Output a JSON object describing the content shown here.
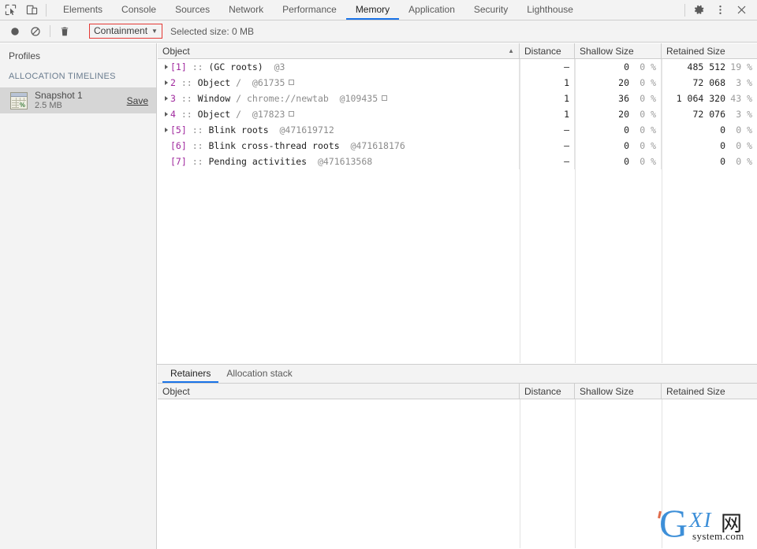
{
  "window": {
    "title": "Chrome DevTools — Memory"
  },
  "tabbar": {
    "inspect_icon": "inspect-cursor-icon",
    "device_icon": "device-toolbar-icon",
    "tabs": [
      {
        "label": "Elements",
        "active": false
      },
      {
        "label": "Console",
        "active": false
      },
      {
        "label": "Sources",
        "active": false
      },
      {
        "label": "Network",
        "active": false
      },
      {
        "label": "Performance",
        "active": false
      },
      {
        "label": "Memory",
        "active": true
      },
      {
        "label": "Application",
        "active": false
      },
      {
        "label": "Security",
        "active": false
      },
      {
        "label": "Lighthouse",
        "active": false
      }
    ],
    "settings_icon": "gear-icon",
    "more_icon": "kebab-menu-icon",
    "close_icon": "close-icon",
    "accent_color": "#1a73e8"
  },
  "toolbar": {
    "record_icon": "record-circle-icon",
    "clear_icon": "no-entry-icon",
    "delete_icon": "trash-icon",
    "view_select": "Containment",
    "view_select_caret": "▼",
    "selected_size_label": "Selected size: 0 MB",
    "highlight_color": "#e53935"
  },
  "sidebar": {
    "title": "Profiles",
    "section_label": "ALLOCATION TIMELINES",
    "item": {
      "icon": "heap-snapshot-icon",
      "icon_badge": "%",
      "name": "Snapshot 1",
      "size": "2.5 MB",
      "save_label": "Save"
    }
  },
  "main_grid": {
    "columns": [
      {
        "key": "object",
        "label": "Object",
        "sort": "▲"
      },
      {
        "key": "distance",
        "label": "Distance",
        "sort": ""
      },
      {
        "key": "shallow",
        "label": "Shallow Size",
        "sort": ""
      },
      {
        "key": "retained",
        "label": "Retained Size",
        "sort": ""
      }
    ],
    "rows": [
      {
        "expandable": true,
        "index": "[1]",
        "sep": "::",
        "name": "(GC roots)",
        "path": "",
        "id": "@3",
        "has_square": false,
        "distance": "–",
        "shallow": "0",
        "shallow_pct": "0 %",
        "retained": "485 512",
        "retained_pct": "19 %"
      },
      {
        "expandable": true,
        "index": "2",
        "sep": "::",
        "name": "Object",
        "path": "/",
        "id": "@61735",
        "has_square": true,
        "distance": "1",
        "shallow": "20",
        "shallow_pct": "0 %",
        "retained": "72 068",
        "retained_pct": "3 %"
      },
      {
        "expandable": true,
        "index": "3",
        "sep": "::",
        "name": "Window",
        "path": "/ chrome://newtab",
        "id": "@109435",
        "has_square": true,
        "distance": "1",
        "shallow": "36",
        "shallow_pct": "0 %",
        "retained": "1 064 320",
        "retained_pct": "43 %"
      },
      {
        "expandable": true,
        "index": "4",
        "sep": "::",
        "name": "Object",
        "path": "/",
        "id": "@17823",
        "has_square": true,
        "distance": "1",
        "shallow": "20",
        "shallow_pct": "0 %",
        "retained": "72 076",
        "retained_pct": "3 %"
      },
      {
        "expandable": true,
        "index": "[5]",
        "sep": "::",
        "name": "Blink roots",
        "path": "",
        "id": "@471619712",
        "has_square": false,
        "distance": "–",
        "shallow": "0",
        "shallow_pct": "0 %",
        "retained": "0",
        "retained_pct": "0 %"
      },
      {
        "expandable": false,
        "index": "[6]",
        "sep": "::",
        "name": "Blink cross-thread roots",
        "path": "",
        "id": "@471618176",
        "has_square": false,
        "distance": "–",
        "shallow": "0",
        "shallow_pct": "0 %",
        "retained": "0",
        "retained_pct": "0 %"
      },
      {
        "expandable": false,
        "index": "[7]",
        "sep": "::",
        "name": "Pending activities",
        "path": "",
        "id": "@471613568",
        "has_square": false,
        "distance": "–",
        "shallow": "0",
        "shallow_pct": "0 %",
        "retained": "0",
        "retained_pct": "0 %"
      }
    ]
  },
  "bottom_panel": {
    "tabs": [
      {
        "label": "Retainers",
        "active": true
      },
      {
        "label": "Allocation stack",
        "active": false
      }
    ],
    "columns": [
      {
        "key": "object",
        "label": "Object"
      },
      {
        "key": "distance",
        "label": "Distance"
      },
      {
        "key": "shallow",
        "label": "Shallow Size"
      },
      {
        "key": "retained",
        "label": "Retained Size"
      }
    ],
    "rows": []
  },
  "watermark": {
    "letter": "G",
    "xi": "XI",
    "cn": "网",
    "domain": "system.com"
  }
}
